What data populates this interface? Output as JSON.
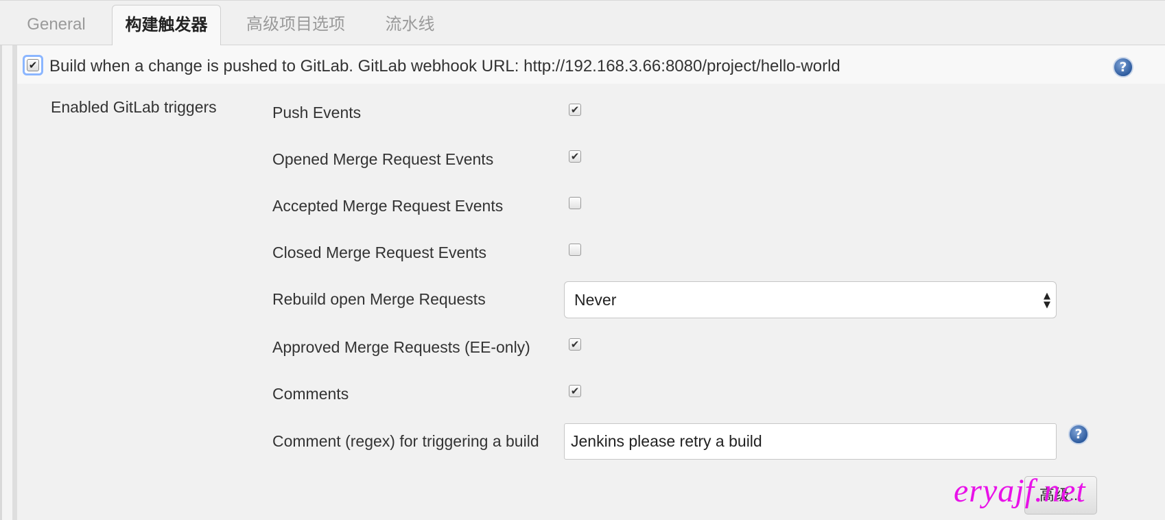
{
  "tabs": [
    {
      "label": "General"
    },
    {
      "label": "构建触发器"
    },
    {
      "label": "高级项目选项"
    },
    {
      "label": "流水线"
    }
  ],
  "section": {
    "checkbox_checked": true,
    "title": "Build when a change is pushed to GitLab. GitLab webhook URL: http://192.168.3.66:8080/project/hello-world"
  },
  "triggers": {
    "group_label": "Enabled GitLab triggers",
    "push_events": {
      "label": "Push Events",
      "checked": true
    },
    "opened_mr": {
      "label": "Opened Merge Request Events",
      "checked": true
    },
    "accepted_mr": {
      "label": "Accepted Merge Request Events",
      "checked": false
    },
    "closed_mr": {
      "label": "Closed Merge Request Events",
      "checked": false
    },
    "rebuild_open_mr": {
      "label": "Rebuild open Merge Requests",
      "value": "Never"
    },
    "approved_mr": {
      "label": "Approved Merge Requests (EE-only)",
      "checked": true
    },
    "comments": {
      "label": "Comments",
      "checked": true
    },
    "comment_regex": {
      "label": "Comment (regex) for triggering a build",
      "value": "Jenkins please retry a build"
    }
  },
  "advanced_button": {
    "label": "高级..."
  },
  "watermark": {
    "text": "eryajf.net"
  },
  "icons": {
    "help": "help-icon",
    "checkmark": "✔",
    "select_arrows": "▲▼"
  },
  "colors": {
    "help_blue": "#2e5c9f",
    "focus_ring": "#8bb6ff",
    "watermark": "#e812e8"
  }
}
